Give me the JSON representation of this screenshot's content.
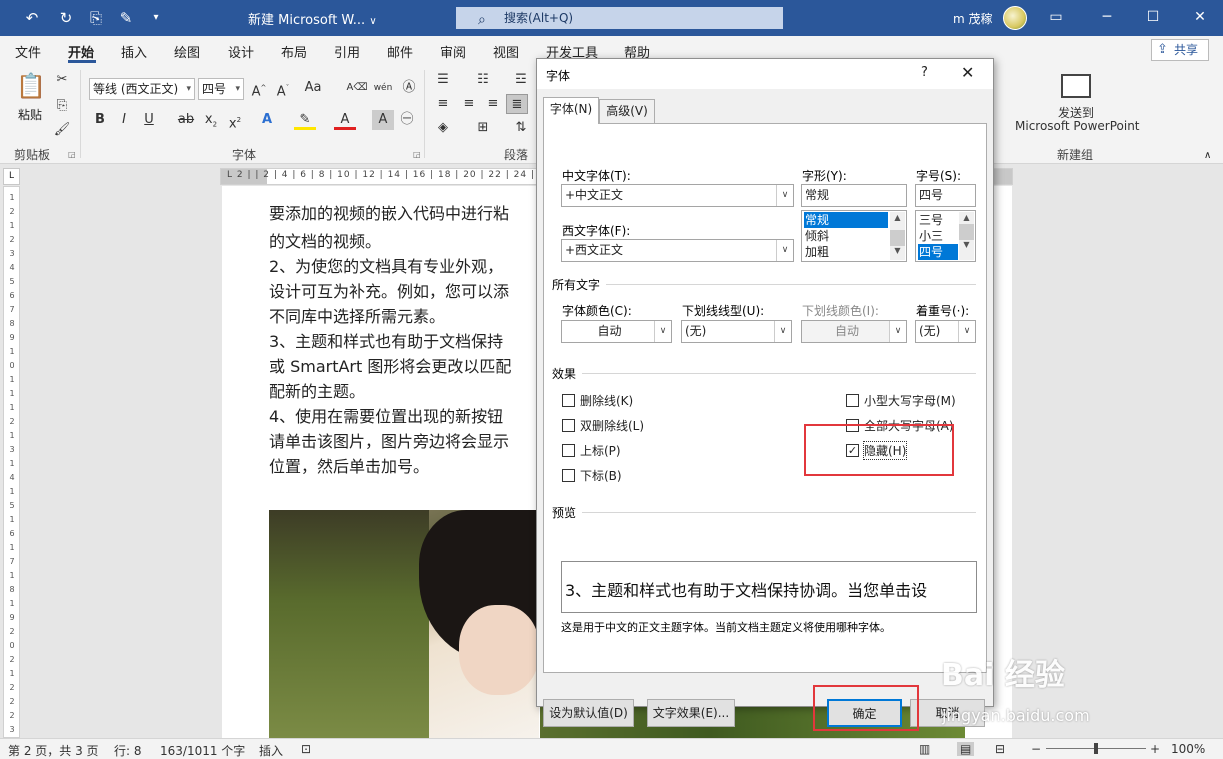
{
  "app": {
    "doc_title": "新建 Microsoft W...",
    "search_placeholder": "搜索(Alt+Q)",
    "user_name": "m 茂稼",
    "accent_color": "#2b579a"
  },
  "menu": {
    "tabs": [
      "文件",
      "开始",
      "插入",
      "绘图",
      "设计",
      "布局",
      "引用",
      "邮件",
      "审阅",
      "视图",
      "开发工具",
      "帮助"
    ],
    "active": "开始",
    "share": "共享"
  },
  "ribbon": {
    "paste_label": "粘贴",
    "clipboard_group": "剪贴板",
    "font_name": "等线 (西文正文)",
    "font_size": "四号",
    "font_group": "字体",
    "paragraph_group": "段落",
    "send_to_line1": "发送到",
    "send_to_line2": "Microsoft PowerPoint",
    "new_group": "新建组"
  },
  "ruler_text": "L 2 | | 2 | 4 | 6 | 8 | 10 | 12 | 14 | 16 | 18 | 20 | 22 | 24 |",
  "vruler_text": "1 2 1 2 3 4 5 6 7 8 9 10 11 12 13 14 15 16 17 18 19 20 21 22 23",
  "document": {
    "lines": [
      "要添加的视频的嵌入代码中进行粘",
      "的文档的视频。",
      "2、为使您的文档具有专业外观，",
      "设计可互为补充。例如，您可以添",
      "不同库中选择所需元素。",
      "3、主题和样式也有助于文档保持",
      "或  SmartArt  图形将会更改以匹配",
      "配新的主题。",
      "4、使用在需要位置出现的新按钮",
      "请单击该图片，图片旁边将会显示",
      "位置，然后单击加号。"
    ]
  },
  "status": {
    "page": "第 2 页，共 3 页",
    "line": "行: 8",
    "words": "163/1011 个字",
    "mode": "插入",
    "zoom": "100%"
  },
  "dialog": {
    "title": "字体",
    "help": "?",
    "tabs": [
      "字体(N)",
      "高级(V)"
    ],
    "cn_font_label": "中文字体(T):",
    "cn_font_value": "+中文正文",
    "west_font_label": "西文字体(F):",
    "west_font_value": "+西文正文",
    "style_label": "字形(Y):",
    "style_value": "常规",
    "style_options": [
      "常规",
      "倾斜",
      "加粗"
    ],
    "style_selected": "常规",
    "size_label": "字号(S):",
    "size_value": "四号",
    "size_options": [
      "三号",
      "小三",
      "四号"
    ],
    "size_selected": "四号",
    "all_text_section": "所有文字",
    "font_color_label": "字体颜色(C):",
    "font_color_value": "自动",
    "underline_type_label": "下划线线型(U):",
    "underline_type_value": "(无)",
    "underline_color_label": "下划线颜色(I):",
    "underline_color_value": "自动",
    "emphasis_label": "着重号(·):",
    "emphasis_value": "(无)",
    "effects_section": "效果",
    "effects_left": [
      {
        "label": "删除线(K)",
        "checked": false
      },
      {
        "label": "双删除线(L)",
        "checked": false
      },
      {
        "label": "上标(P)",
        "checked": false
      },
      {
        "label": "下标(B)",
        "checked": false
      }
    ],
    "effects_right": [
      {
        "label": "小型大写字母(M)",
        "checked": false
      },
      {
        "label": "全部大写字母(A)",
        "checked": false
      },
      {
        "label": "隐藏(H)",
        "checked": true
      }
    ],
    "preview_section": "预览",
    "preview_text": "3、主题和样式也有助于文档保持协调。当您单击设",
    "preview_note": "这是用于中文的正文主题字体。当前文档主题定义将使用哪种字体。",
    "btn_default": "设为默认值(D)",
    "btn_effects": "文字效果(E)...",
    "btn_ok": "确定",
    "btn_cancel": "取消",
    "highlight_color": "#e2373c"
  },
  "watermark": {
    "text": "Bai 经验",
    "sub": "jingyan.baidu.com"
  }
}
